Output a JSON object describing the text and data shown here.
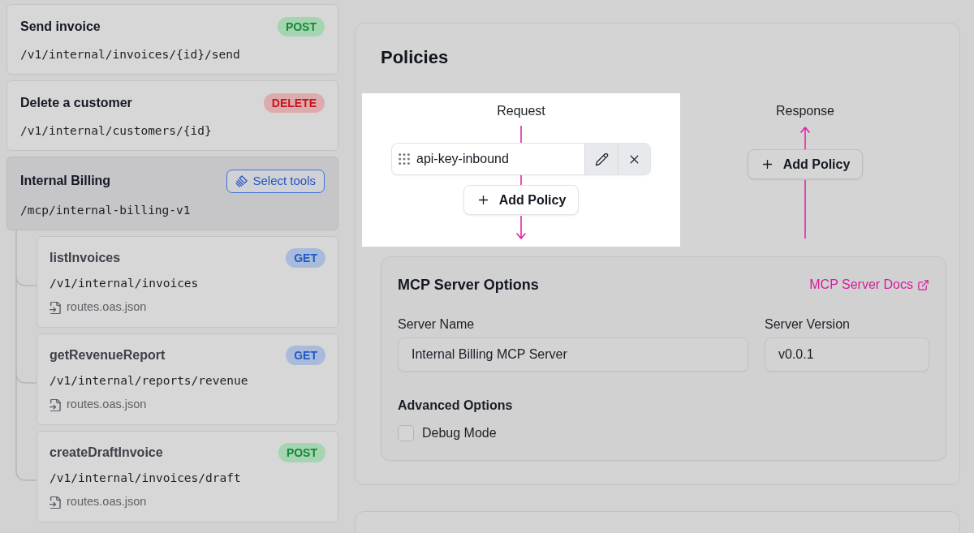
{
  "routes": [
    {
      "kind": "endpoint",
      "title": "Send invoice",
      "badge": {
        "kind": "post",
        "text": "POST"
      },
      "path": "/v1/internal/invoices/{id}/send",
      "selected": false
    },
    {
      "kind": "endpoint",
      "title": "Delete a customer",
      "badge": {
        "kind": "delete",
        "text": "DELETE"
      },
      "path": "/v1/internal/customers/{id}",
      "selected": false
    },
    {
      "kind": "mcp",
      "title": "Internal Billing",
      "action": "Select tools",
      "path": "/mcp/internal-billing-v1",
      "selected": true,
      "tools": [
        {
          "title": "listInvoices",
          "badge": {
            "kind": "get",
            "text": "GET"
          },
          "path": "/v1/internal/invoices",
          "source": "routes.oas.json"
        },
        {
          "title": "getRevenueReport",
          "badge": {
            "kind": "get",
            "text": "GET"
          },
          "path": "/v1/internal/reports/revenue",
          "source": "routes.oas.json"
        },
        {
          "title": "createDraftInvoice",
          "badge": {
            "kind": "post",
            "text": "POST"
          },
          "path": "/v1/internal/invoices/draft",
          "source": "routes.oas.json"
        }
      ]
    }
  ],
  "policies": {
    "title": "Policies",
    "flows": [
      {
        "kind": "request",
        "label": "Request",
        "highlighted": true,
        "policies": [
          {
            "name": "api-key-inbound"
          }
        ],
        "add_label": "Add Policy"
      },
      {
        "kind": "response",
        "label": "Response",
        "highlighted": false,
        "add_label": "Add Policy"
      }
    ]
  },
  "mcp_server_options": {
    "title": "MCP Server Options",
    "docs_link": "MCP Server Docs",
    "fields": [
      {
        "label": "Server Name",
        "value": "Internal Billing MCP Server"
      },
      {
        "label": "Server Version",
        "value": "v0.0.1"
      }
    ],
    "advanced": {
      "title": "Advanced Options",
      "options": [
        {
          "label": "Debug Mode",
          "checked": false
        }
      ]
    }
  }
}
